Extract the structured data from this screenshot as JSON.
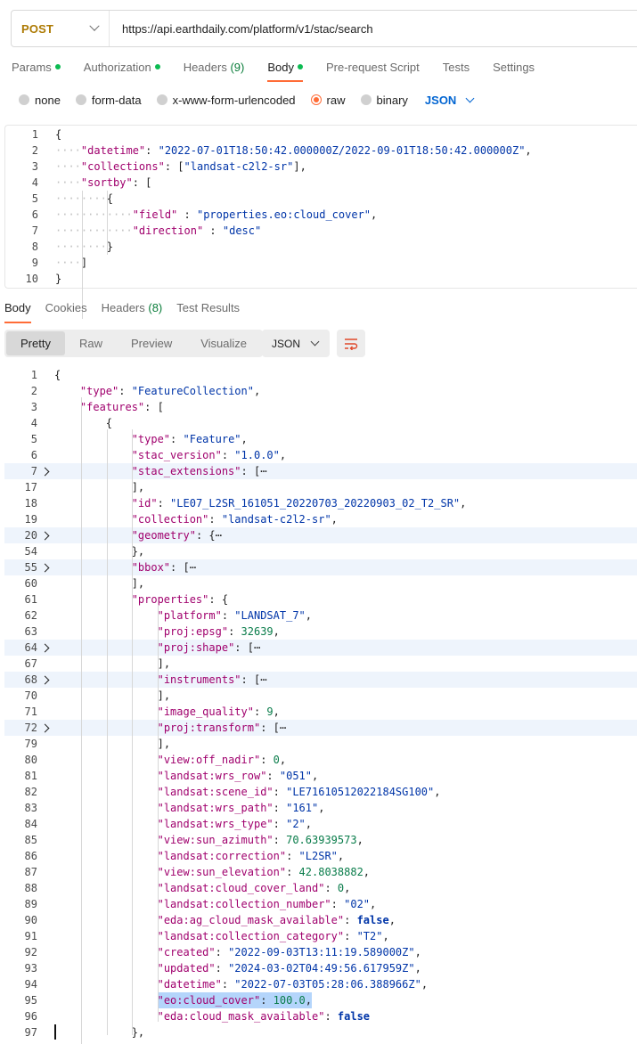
{
  "request": {
    "method": "POST",
    "url": "https://api.earthdaily.com/platform/v1/stac/search"
  },
  "request_tabs": [
    {
      "label": "Params",
      "dot": true
    },
    {
      "label": "Authorization",
      "dot": true
    },
    {
      "label": "Headers ",
      "count": "(9)"
    },
    {
      "label": "Body",
      "dot": true,
      "active": true
    },
    {
      "label": "Pre-request Script"
    },
    {
      "label": "Tests"
    },
    {
      "label": "Settings"
    }
  ],
  "body_types": [
    "none",
    "form-data",
    "x-www-form-urlencoded",
    "raw",
    "binary"
  ],
  "body_type_selected": "raw",
  "body_format": "JSON",
  "request_body": [
    {
      "n": "1",
      "tokens": [
        [
          "p",
          "{"
        ]
      ]
    },
    {
      "n": "2",
      "tokens": [
        [
          "ws",
          "····"
        ],
        [
          "k",
          "\"datetime\""
        ],
        [
          "p",
          ": "
        ],
        [
          "s",
          "\"2022-07-01T18:50:42.000000Z/2022-09-01T18:50:42.000000Z\""
        ],
        [
          "p",
          ","
        ]
      ]
    },
    {
      "n": "3",
      "tokens": [
        [
          "ws",
          "····"
        ],
        [
          "k",
          "\"collections\""
        ],
        [
          "p",
          ": ["
        ],
        [
          "s",
          "\"landsat-c2l2-sr\""
        ],
        [
          "p",
          "],"
        ]
      ]
    },
    {
      "n": "4",
      "tokens": [
        [
          "ws",
          "····"
        ],
        [
          "k",
          "\"sortby\""
        ],
        [
          "p",
          ": ["
        ]
      ]
    },
    {
      "n": "5",
      "tokens": [
        [
          "ws",
          "········"
        ],
        [
          "p",
          "{"
        ]
      ]
    },
    {
      "n": "6",
      "tokens": [
        [
          "ws",
          "············"
        ],
        [
          "k",
          "\"field\""
        ],
        [
          "p",
          " : "
        ],
        [
          "s",
          "\"properties.eo:cloud_cover\""
        ],
        [
          "p",
          ","
        ]
      ]
    },
    {
      "n": "7",
      "tokens": [
        [
          "ws",
          "············"
        ],
        [
          "k",
          "\"direction\""
        ],
        [
          "p",
          " : "
        ],
        [
          "s",
          "\"desc\""
        ]
      ]
    },
    {
      "n": "8",
      "tokens": [
        [
          "ws",
          "········"
        ],
        [
          "p",
          "}"
        ]
      ]
    },
    {
      "n": "9",
      "tokens": [
        [
          "ws",
          "····"
        ],
        [
          "p",
          "]"
        ]
      ]
    },
    {
      "n": "10",
      "tokens": [
        [
          "p",
          "}"
        ]
      ]
    }
  ],
  "response_tabs": [
    {
      "label": "Body",
      "active": true
    },
    {
      "label": "Cookies"
    },
    {
      "label": "Headers ",
      "count": "(8)"
    },
    {
      "label": "Test Results"
    }
  ],
  "response_formats": [
    "Pretty",
    "Raw",
    "Preview",
    "Visualize"
  ],
  "response_format_selected": "Pretty",
  "response_language": "JSON",
  "response_body": [
    {
      "n": "1",
      "i": 0,
      "tokens": [
        [
          "p",
          "{"
        ]
      ]
    },
    {
      "n": "2",
      "i": 1,
      "tokens": [
        [
          "k",
          "\"type\""
        ],
        [
          "p",
          ": "
        ],
        [
          "s",
          "\"FeatureCollection\""
        ],
        [
          "p",
          ","
        ]
      ]
    },
    {
      "n": "3",
      "i": 1,
      "tokens": [
        [
          "k",
          "\"features\""
        ],
        [
          "p",
          ": ["
        ]
      ]
    },
    {
      "n": "4",
      "i": 2,
      "tokens": [
        [
          "p",
          "{"
        ]
      ]
    },
    {
      "n": "5",
      "i": 3,
      "tokens": [
        [
          "k",
          "\"type\""
        ],
        [
          "p",
          ": "
        ],
        [
          "s",
          "\"Feature\""
        ],
        [
          "p",
          ","
        ]
      ]
    },
    {
      "n": "6",
      "i": 3,
      "tokens": [
        [
          "k",
          "\"stac_version\""
        ],
        [
          "p",
          ": "
        ],
        [
          "s",
          "\"1.0.0\""
        ],
        [
          "p",
          ","
        ]
      ]
    },
    {
      "n": "7",
      "i": 3,
      "fold": true,
      "tokens": [
        [
          "k",
          "\"stac_extensions\""
        ],
        [
          "p",
          ": [⋯"
        ]
      ]
    },
    {
      "n": "17",
      "i": 3,
      "tokens": [
        [
          "p",
          "],"
        ]
      ]
    },
    {
      "n": "18",
      "i": 3,
      "tokens": [
        [
          "k",
          "\"id\""
        ],
        [
          "p",
          ": "
        ],
        [
          "s",
          "\"LE07_L2SR_161051_20220703_20220903_02_T2_SR\""
        ],
        [
          "p",
          ","
        ]
      ]
    },
    {
      "n": "19",
      "i": 3,
      "tokens": [
        [
          "k",
          "\"collection\""
        ],
        [
          "p",
          ": "
        ],
        [
          "s",
          "\"landsat-c2l2-sr\""
        ],
        [
          "p",
          ","
        ]
      ]
    },
    {
      "n": "20",
      "i": 3,
      "fold": true,
      "tokens": [
        [
          "k",
          "\"geometry\""
        ],
        [
          "p",
          ": {⋯"
        ]
      ]
    },
    {
      "n": "54",
      "i": 3,
      "tokens": [
        [
          "p",
          "},"
        ]
      ]
    },
    {
      "n": "55",
      "i": 3,
      "fold": true,
      "tokens": [
        [
          "k",
          "\"bbox\""
        ],
        [
          "p",
          ": [⋯"
        ]
      ]
    },
    {
      "n": "60",
      "i": 3,
      "tokens": [
        [
          "p",
          "],"
        ]
      ]
    },
    {
      "n": "61",
      "i": 3,
      "tokens": [
        [
          "k",
          "\"properties\""
        ],
        [
          "p",
          ": {"
        ]
      ]
    },
    {
      "n": "62",
      "i": 4,
      "tokens": [
        [
          "k",
          "\"platform\""
        ],
        [
          "p",
          ": "
        ],
        [
          "s",
          "\"LANDSAT_7\""
        ],
        [
          "p",
          ","
        ]
      ]
    },
    {
      "n": "63",
      "i": 4,
      "tokens": [
        [
          "k",
          "\"proj:epsg\""
        ],
        [
          "p",
          ": "
        ],
        [
          "n",
          "32639"
        ],
        [
          "p",
          ","
        ]
      ]
    },
    {
      "n": "64",
      "i": 4,
      "fold": true,
      "tokens": [
        [
          "k",
          "\"proj:shape\""
        ],
        [
          "p",
          ": [⋯"
        ]
      ]
    },
    {
      "n": "67",
      "i": 4,
      "tokens": [
        [
          "p",
          "],"
        ]
      ]
    },
    {
      "n": "68",
      "i": 4,
      "fold": true,
      "tokens": [
        [
          "k",
          "\"instruments\""
        ],
        [
          "p",
          ": [⋯"
        ]
      ]
    },
    {
      "n": "70",
      "i": 4,
      "tokens": [
        [
          "p",
          "],"
        ]
      ]
    },
    {
      "n": "71",
      "i": 4,
      "tokens": [
        [
          "k",
          "\"image_quality\""
        ],
        [
          "p",
          ": "
        ],
        [
          "n",
          "9"
        ],
        [
          "p",
          ","
        ]
      ]
    },
    {
      "n": "72",
      "i": 4,
      "fold": true,
      "tokens": [
        [
          "k",
          "\"proj:transform\""
        ],
        [
          "p",
          ": [⋯"
        ]
      ]
    },
    {
      "n": "79",
      "i": 4,
      "tokens": [
        [
          "p",
          "],"
        ]
      ]
    },
    {
      "n": "80",
      "i": 4,
      "tokens": [
        [
          "k",
          "\"view:off_nadir\""
        ],
        [
          "p",
          ": "
        ],
        [
          "n",
          "0"
        ],
        [
          "p",
          ","
        ]
      ]
    },
    {
      "n": "81",
      "i": 4,
      "tokens": [
        [
          "k",
          "\"landsat:wrs_row\""
        ],
        [
          "p",
          ": "
        ],
        [
          "s",
          "\"051\""
        ],
        [
          "p",
          ","
        ]
      ]
    },
    {
      "n": "82",
      "i": 4,
      "tokens": [
        [
          "k",
          "\"landsat:scene_id\""
        ],
        [
          "p",
          ": "
        ],
        [
          "s",
          "\"LE71610512022184SG100\""
        ],
        [
          "p",
          ","
        ]
      ]
    },
    {
      "n": "83",
      "i": 4,
      "tokens": [
        [
          "k",
          "\"landsat:wrs_path\""
        ],
        [
          "p",
          ": "
        ],
        [
          "s",
          "\"161\""
        ],
        [
          "p",
          ","
        ]
      ]
    },
    {
      "n": "84",
      "i": 4,
      "tokens": [
        [
          "k",
          "\"landsat:wrs_type\""
        ],
        [
          "p",
          ": "
        ],
        [
          "s",
          "\"2\""
        ],
        [
          "p",
          ","
        ]
      ]
    },
    {
      "n": "85",
      "i": 4,
      "tokens": [
        [
          "k",
          "\"view:sun_azimuth\""
        ],
        [
          "p",
          ": "
        ],
        [
          "n",
          "70.63939573"
        ],
        [
          "p",
          ","
        ]
      ]
    },
    {
      "n": "86",
      "i": 4,
      "tokens": [
        [
          "k",
          "\"landsat:correction\""
        ],
        [
          "p",
          ": "
        ],
        [
          "s",
          "\"L2SR\""
        ],
        [
          "p",
          ","
        ]
      ]
    },
    {
      "n": "87",
      "i": 4,
      "tokens": [
        [
          "k",
          "\"view:sun_elevation\""
        ],
        [
          "p",
          ": "
        ],
        [
          "n",
          "42.8038882"
        ],
        [
          "p",
          ","
        ]
      ]
    },
    {
      "n": "88",
      "i": 4,
      "tokens": [
        [
          "k",
          "\"landsat:cloud_cover_land\""
        ],
        [
          "p",
          ": "
        ],
        [
          "n",
          "0"
        ],
        [
          "p",
          ","
        ]
      ]
    },
    {
      "n": "89",
      "i": 4,
      "tokens": [
        [
          "k",
          "\"landsat:collection_number\""
        ],
        [
          "p",
          ": "
        ],
        [
          "s",
          "\"02\""
        ],
        [
          "p",
          ","
        ]
      ]
    },
    {
      "n": "90",
      "i": 4,
      "tokens": [
        [
          "k",
          "\"eda:ag_cloud_mask_available\""
        ],
        [
          "p",
          ": "
        ],
        [
          "b",
          "false"
        ],
        [
          "p",
          ","
        ]
      ]
    },
    {
      "n": "91",
      "i": 4,
      "tokens": [
        [
          "k",
          "\"landsat:collection_category\""
        ],
        [
          "p",
          ": "
        ],
        [
          "s",
          "\"T2\""
        ],
        [
          "p",
          ","
        ]
      ]
    },
    {
      "n": "92",
      "i": 4,
      "tokens": [
        [
          "k",
          "\"created\""
        ],
        [
          "p",
          ": "
        ],
        [
          "s",
          "\"2022-09-03T13:11:19.589000Z\""
        ],
        [
          "p",
          ","
        ]
      ]
    },
    {
      "n": "93",
      "i": 4,
      "tokens": [
        [
          "k",
          "\"updated\""
        ],
        [
          "p",
          ": "
        ],
        [
          "s",
          "\"2024-03-02T04:49:56.617959Z\""
        ],
        [
          "p",
          ","
        ]
      ]
    },
    {
      "n": "94",
      "i": 4,
      "tokens": [
        [
          "k",
          "\"datetime\""
        ],
        [
          "p",
          ": "
        ],
        [
          "s",
          "\"2022-07-03T05:28:06.388966Z\""
        ],
        [
          "p",
          ","
        ]
      ]
    },
    {
      "n": "95",
      "i": 4,
      "selected": true,
      "tokens": [
        [
          "k",
          "\"eo:cloud_cover\""
        ],
        [
          "p",
          ": "
        ],
        [
          "n",
          "100.0"
        ],
        [
          "p",
          ","
        ]
      ]
    },
    {
      "n": "96",
      "i": 4,
      "tokens": [
        [
          "k",
          "\"eda:cloud_mask_available\""
        ],
        [
          "p",
          ": "
        ],
        [
          "b",
          "false"
        ]
      ]
    },
    {
      "n": "97",
      "i": 3,
      "tokens": [
        [
          "p",
          "},"
        ]
      ]
    }
  ],
  "icons": {
    "method_dropdown": "chevron-down-icon",
    "body_format_dropdown": "chevron-down-icon",
    "wrap_lines": "wrap-lines-icon",
    "fold": "chevron-right-icon"
  },
  "colors": {
    "accent": "#ff6c37",
    "method": "#ad7a03",
    "status_dot": "#0cbb52",
    "json_key": "#a0006d",
    "json_string": "#0035a8",
    "json_number": "#097c4a"
  }
}
